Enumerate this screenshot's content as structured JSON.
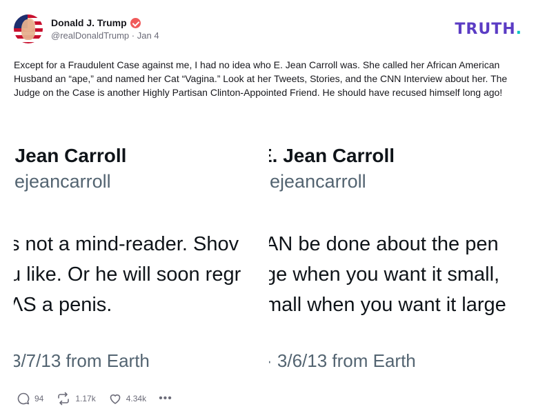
{
  "author": {
    "name": "Donald J. Trump",
    "handle": "@realDonaldTrump",
    "separator": "·",
    "date": "Jan 4"
  },
  "brand": {
    "logo_text": "TRUTH",
    "logo_dot": "."
  },
  "post": {
    "text": "Except for a Fraudulent Case against me, I had no idea who E. Jean Carroll was. She called her African American Husband an “ape,” and named her Cat “Vagina.” Look at her Tweets, Stories, and the CNN Interview about her. The Judge on the Case is another Highly Partisan Clinton-Appointed Friend. He should have recused himself long ago!"
  },
  "image": {
    "left_tweet": {
      "name": ". Jean Carroll",
      "handle": "ɒejeancarroll",
      "lines": [
        "s not a mind-reader. Shov",
        "u like. Or he will soon regr",
        "ΛS a penis."
      ],
      "date": "3/7/13 from Earth"
    },
    "right_tweet": {
      "name": "Ε. Jean Carroll",
      "handle": "ɒejeancarroll",
      "lines": [
        "AN be done about the pen",
        "ge when you want it small,",
        "mall when you want it large"
      ],
      "date": "· 3/6/13 from Earth"
    }
  },
  "actions": {
    "replies": "94",
    "retruths": "1.17k",
    "likes": "4.34k",
    "more": "•••"
  },
  "colors": {
    "brand_purple": "#5b3cc4",
    "brand_teal": "#00c2c2",
    "verified": "#f05a5a",
    "muted": "#6b6b78"
  },
  "icons": [
    "verified-badge-icon",
    "reply-icon",
    "retruth-icon",
    "like-icon",
    "more-icon"
  ]
}
